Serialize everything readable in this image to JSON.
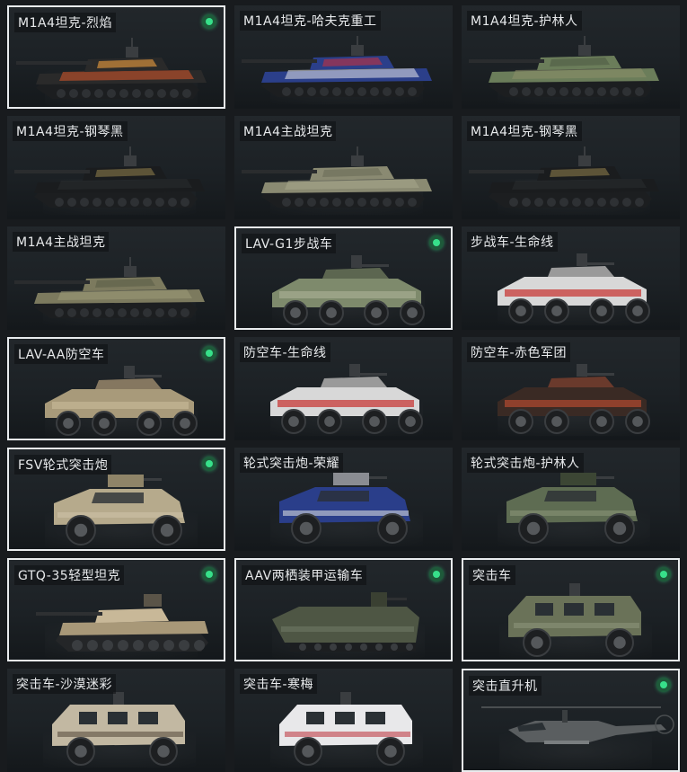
{
  "skins": [
    {
      "name": "M1A4坦克-烈焰",
      "type": "tank",
      "colors": [
        "#2a2a2a",
        "#d8582a",
        "#f0a040"
      ],
      "selected": true,
      "owned": true
    },
    {
      "name": "M1A4坦克-哈夫克重工",
      "type": "tank",
      "colors": [
        "#2b3f8a",
        "#e6e6ea",
        "#c23040"
      ],
      "selected": false,
      "owned": false
    },
    {
      "name": "M1A4坦克-护林人",
      "type": "tank",
      "colors": [
        "#6b7d5a",
        "#8c8f6a",
        "#4e5b44"
      ],
      "selected": false,
      "owned": false
    },
    {
      "name": "M1A4坦克-钢琴黑",
      "type": "tank",
      "colors": [
        "#1a1c1e",
        "#2a2d30",
        "#8a7a4a"
      ],
      "selected": false,
      "owned": false
    },
    {
      "name": "M1A4主战坦克",
      "type": "tank",
      "colors": [
        "#8a8a72",
        "#a8a88c",
        "#6a6c58"
      ],
      "selected": false,
      "owned": false
    },
    {
      "name": "M1A4坦克-钢琴黑",
      "type": "tank",
      "colors": [
        "#1a1c1e",
        "#2a2d30",
        "#8a7a4a"
      ],
      "selected": false,
      "owned": false
    },
    {
      "name": "M1A4主战坦克",
      "type": "tank",
      "colors": [
        "#7c7a5e",
        "#9c9a78",
        "#5c5e48"
      ],
      "selected": false,
      "owned": false
    },
    {
      "name": "LAV-G1步战车",
      "type": "ifv",
      "colors": [
        "#7e8a6c",
        "#a6ac92",
        "#5c6650"
      ],
      "selected": true,
      "owned": true
    },
    {
      "name": "步战车-生命线",
      "type": "ifv",
      "colors": [
        "#d8d8d8",
        "#c8302e",
        "#9a9a9a"
      ],
      "selected": false,
      "owned": false
    },
    {
      "name": "LAV-AA防空车",
      "type": "ifv",
      "colors": [
        "#a89a7a",
        "#c4b696",
        "#857760"
      ],
      "selected": true,
      "owned": true
    },
    {
      "name": "防空车-生命线",
      "type": "ifv",
      "colors": [
        "#d8d8d8",
        "#c8302e",
        "#9a9a9a"
      ],
      "selected": false,
      "owned": false
    },
    {
      "name": "防空车-赤色军团",
      "type": "ifv",
      "colors": [
        "#3a2a24",
        "#b24a30",
        "#6a3a2c"
      ],
      "selected": false,
      "owned": false
    },
    {
      "name": "FSV轮式突击炮",
      "type": "suv",
      "colors": [
        "#b6aa8c",
        "#cdc2a6",
        "#8f8468"
      ],
      "selected": true,
      "owned": true
    },
    {
      "name": "轮式突击炮-荣耀",
      "type": "suv",
      "colors": [
        "#2a3e8a",
        "#d6d8de",
        "#8a8c92"
      ],
      "selected": false,
      "owned": false
    },
    {
      "name": "轮式突击炮-护林人",
      "type": "suv",
      "colors": [
        "#5e6c52",
        "#8a9478",
        "#3c4634"
      ],
      "selected": false,
      "owned": false
    },
    {
      "name": "GTQ-35轻型坦克",
      "type": "light",
      "colors": [
        "#a89878",
        "#c8b898",
        "#7a6c54"
      ],
      "selected": true,
      "owned": true
    },
    {
      "name": "AAV两栖装甲运输车",
      "type": "amphib",
      "colors": [
        "#4e5644",
        "#6a7460",
        "#3a4032"
      ],
      "selected": true,
      "owned": true
    },
    {
      "name": "突击车",
      "type": "truck",
      "colors": [
        "#6a7258",
        "#8c947a",
        "#4c523e"
      ],
      "selected": true,
      "owned": true
    },
    {
      "name": "突击车-沙漠迷彩",
      "type": "truck",
      "colors": [
        "#c2b8a2",
        "#5a4e40",
        "#e0d8c8"
      ],
      "selected": false,
      "owned": false
    },
    {
      "name": "突击车-寒梅",
      "type": "truck",
      "colors": [
        "#e8e8ea",
        "#c04048",
        "#9a9aa0"
      ],
      "selected": false,
      "owned": false
    },
    {
      "name": "突击直升机",
      "type": "heli",
      "colors": [
        "#5a5e60",
        "#7a7e80",
        "#3a3e40"
      ],
      "selected": true,
      "owned": true
    }
  ]
}
